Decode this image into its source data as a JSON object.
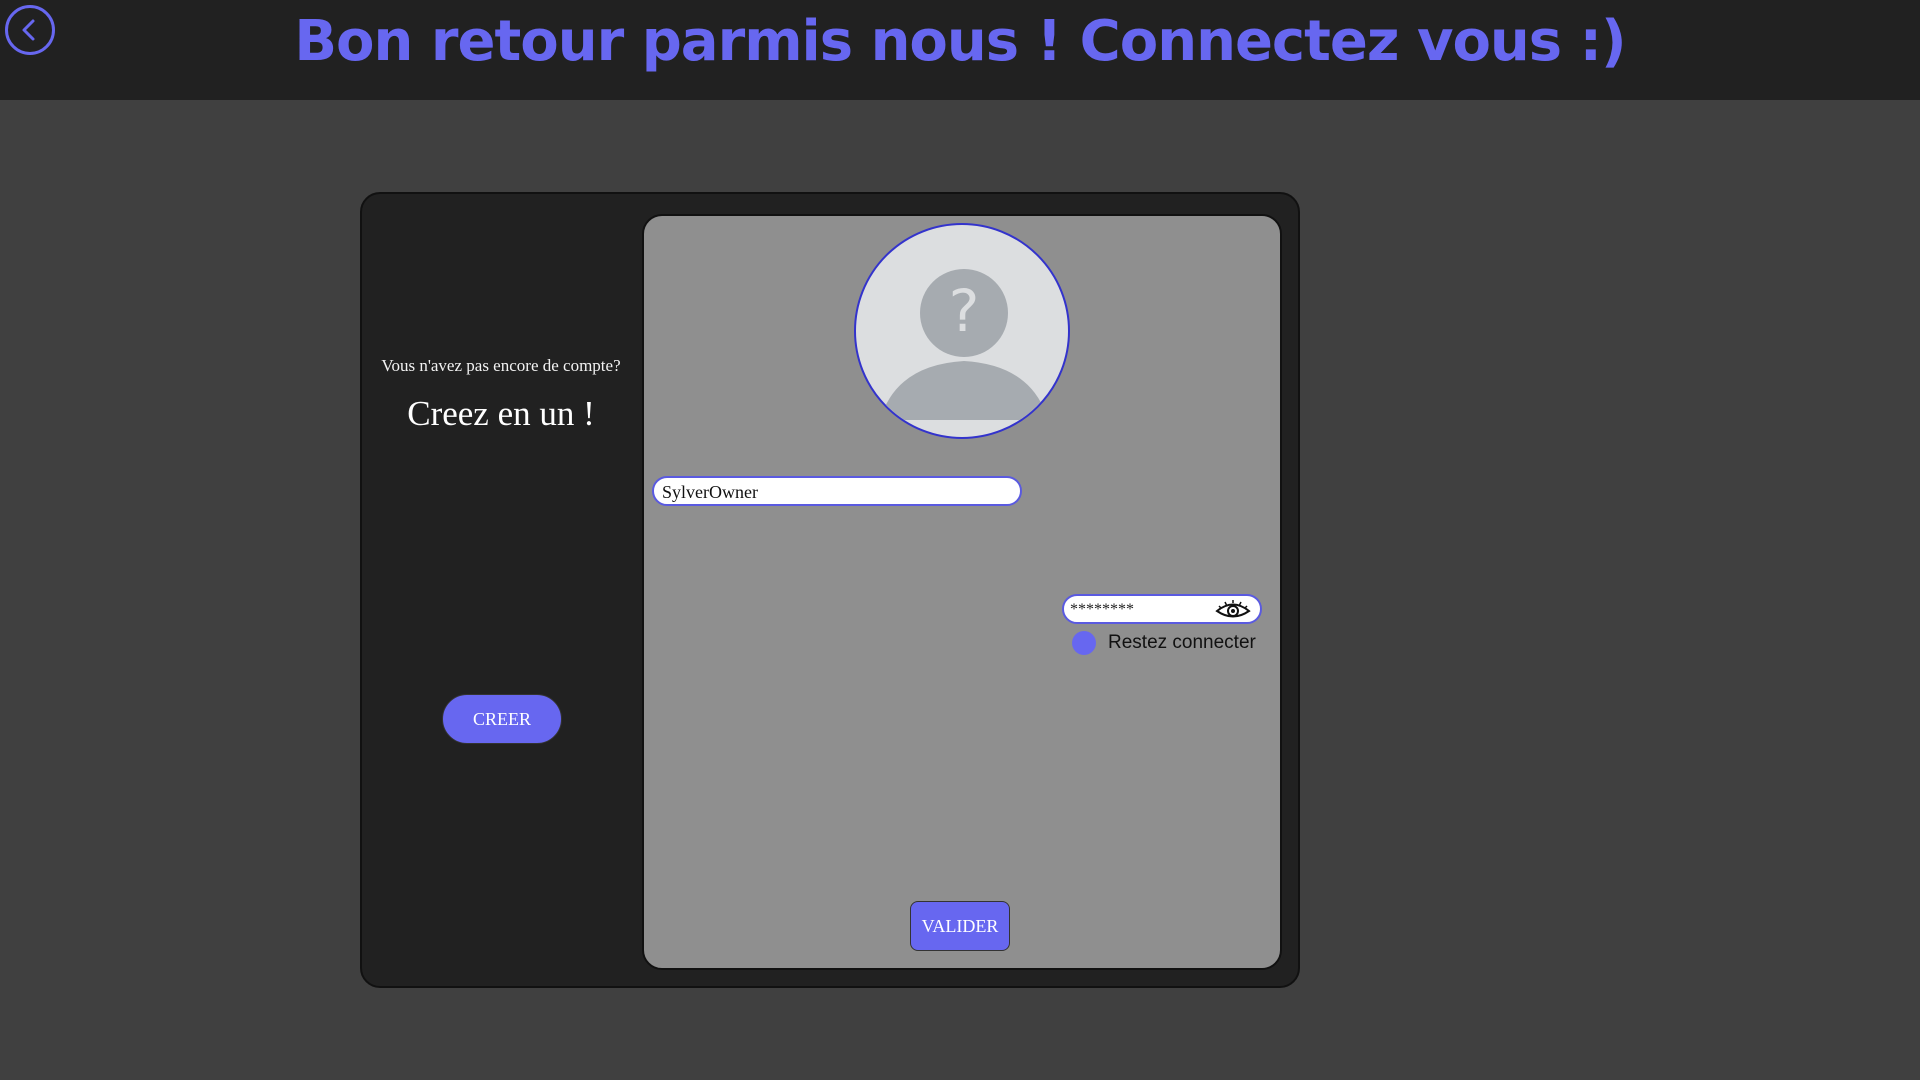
{
  "header": {
    "title": "Bon retour parmis nous ! Connectez vous :)",
    "back_icon": "chevron-left-icon"
  },
  "left_panel": {
    "no_account_text": "Vous n'avez pas encore de compte?",
    "create_text": "Creez en un !",
    "create_button_label": "CREER"
  },
  "login_form": {
    "avatar_icon": "question-mark-user-icon",
    "username_value": "SylverOwner",
    "password_value": "********",
    "password_toggle_icon": "eye-icon",
    "remember_label": "Restez connecter",
    "submit_label": "VALIDER"
  },
  "colors": {
    "accent": "#6767f0",
    "header_bg": "#212121",
    "page_bg": "#404040",
    "form_bg": "#8f8f8f"
  }
}
